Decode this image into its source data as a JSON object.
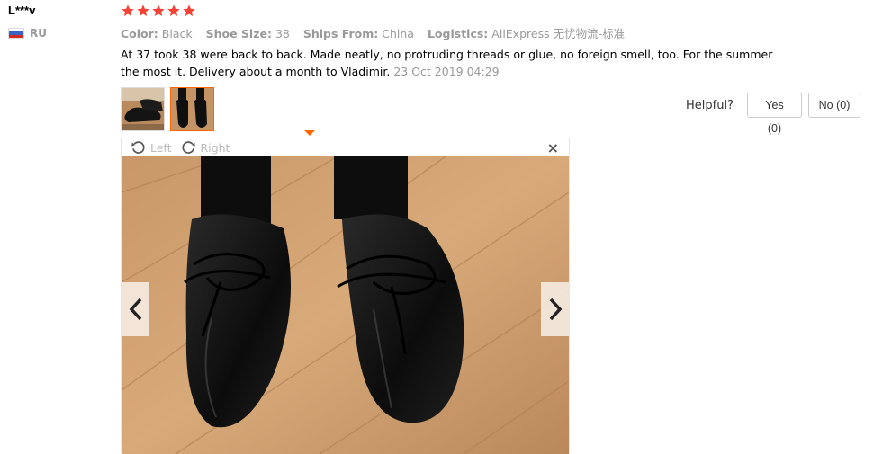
{
  "reviewer": {
    "name": "L***v",
    "country": "RU",
    "rating": 5
  },
  "attributes": [
    {
      "label": "Color:",
      "value": "Black"
    },
    {
      "label": "Shoe Size:",
      "value": "38"
    },
    {
      "label": "Ships From:",
      "value": "China"
    },
    {
      "label": "Logistics:",
      "value": "AliExpress 无忧物流-标准"
    }
  ],
  "review": {
    "text": "At 37 took 38 were back to back. Made neatly, no protruding threads or glue, no foreign smell, too. For the summer the most it. Delivery about a month to Vladimir.",
    "date": "23 Oct 2019 04:29"
  },
  "helpful": {
    "label": "Helpful?",
    "yes": "Yes (0)",
    "no": "No (0)"
  },
  "viewer": {
    "rotate_left": "Left",
    "rotate_right": "Right",
    "close": "×"
  },
  "colors": {
    "star": "#f44336",
    "accent": "#ff6600",
    "muted": "#999999"
  },
  "icons": [
    "star-icon",
    "rotate-left-icon",
    "rotate-right-icon",
    "close-icon",
    "chevron-left-icon",
    "chevron-right-icon",
    "flag-ru-icon"
  ]
}
